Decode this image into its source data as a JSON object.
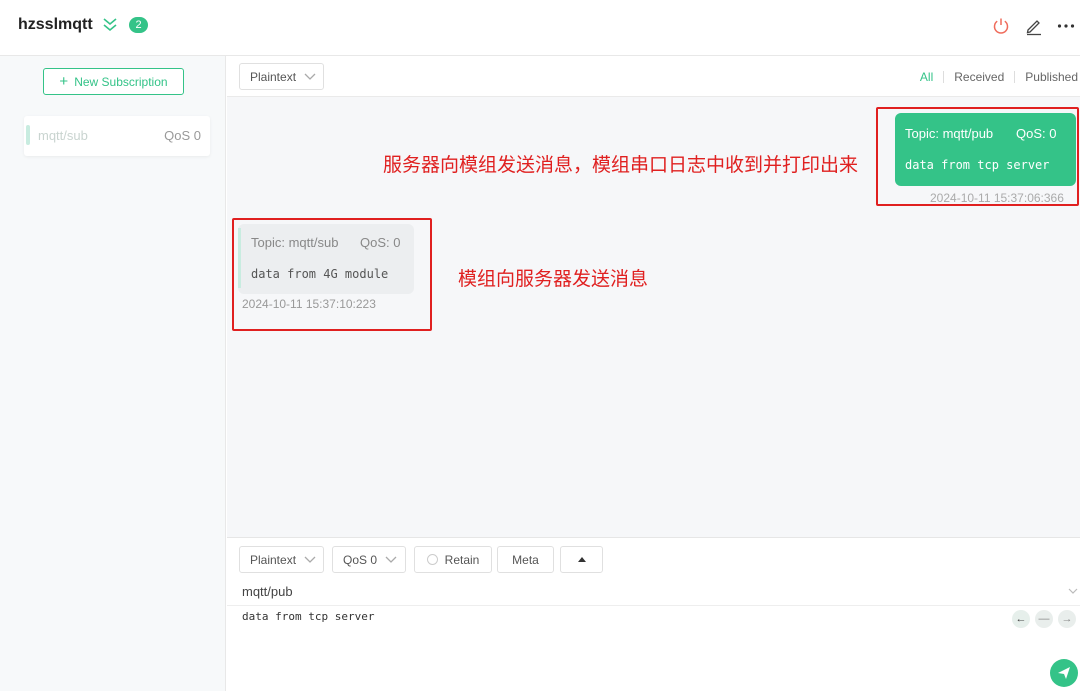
{
  "header": {
    "connection_name": "hzsslmqtt",
    "badge_count": "2",
    "icons": [
      "collapse-icon",
      "power-icon",
      "edit-icon",
      "more-icon"
    ]
  },
  "sidebar": {
    "new_subscription_label": "New Subscription",
    "subscriptions": [
      {
        "topic": "mqtt/sub",
        "qos": "QoS 0",
        "color": "#c8ece0"
      }
    ]
  },
  "toolbar": {
    "payload_format": "Plaintext",
    "filters": [
      "All",
      "Received",
      "Published"
    ],
    "active_filter": "All"
  },
  "messages": [
    {
      "direction": "published",
      "topic": "Topic: mqtt/pub",
      "qos": "QoS: 0",
      "payload": "data from tcp server",
      "time": "2024-10-11 15:37:06:366"
    },
    {
      "direction": "received",
      "topic": "Topic: mqtt/sub",
      "qos": "QoS: 0",
      "payload": "data from 4G module",
      "time": "2024-10-11 15:37:10:223"
    }
  ],
  "annotations": {
    "published_note": "服务器向模组发送消息，模组串口日志中收到并打印出来",
    "received_note": "模组向服务器发送消息"
  },
  "publish": {
    "format": "Plaintext",
    "qos": "QoS 0",
    "retain_label": "Retain",
    "meta_label": "Meta",
    "topic": "mqtt/pub",
    "payload": "data from tcp server"
  },
  "colors": {
    "accent": "#34c388",
    "annotation": "#e02020"
  }
}
